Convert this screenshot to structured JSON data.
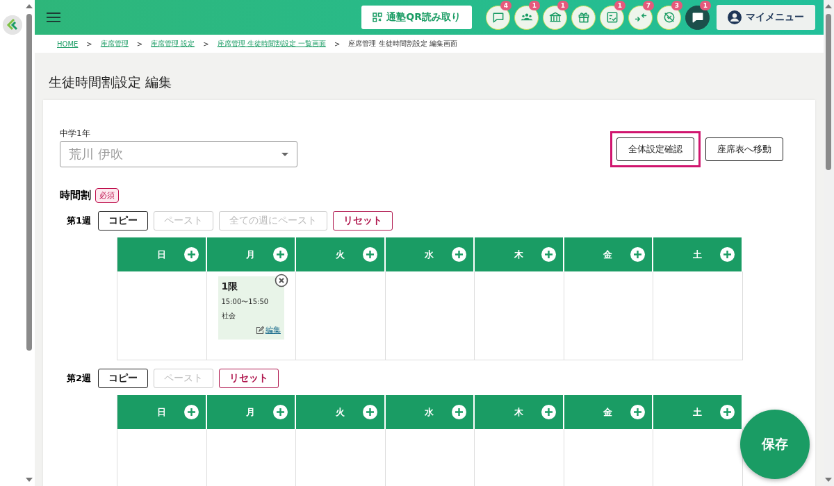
{
  "header": {
    "qr_button": "通塾QR読み取り",
    "icons": [
      {
        "kind": "chat",
        "badge": "4",
        "active": false
      },
      {
        "kind": "group",
        "badge": "1",
        "active": false
      },
      {
        "kind": "school",
        "badge": "1",
        "active": false
      },
      {
        "kind": "gift",
        "active": false
      },
      {
        "kind": "checklist",
        "badge": "1",
        "active": false
      },
      {
        "kind": "merge",
        "badge": "7",
        "active": false
      },
      {
        "kind": "blocked",
        "badge": "3",
        "active": false
      },
      {
        "kind": "chat",
        "badge": "1",
        "active": true
      }
    ],
    "menu": "マイメニュー"
  },
  "breadcrumb": [
    {
      "kind": "link",
      "label": "HOME"
    },
    {
      "kind": "separator",
      "label": ">"
    },
    {
      "kind": "link",
      "label": "座席管理"
    },
    {
      "kind": "separator",
      "label": ">"
    },
    {
      "kind": "link",
      "label": "座席管理 設定"
    },
    {
      "kind": "separator",
      "label": ">"
    },
    {
      "kind": "link",
      "label": "座席管理 生徒時間割設定 一覧画面"
    },
    {
      "kind": "separator",
      "label": ">"
    },
    {
      "kind": "current",
      "label": "座席管理 生徒時間割設定 編集画面"
    }
  ],
  "page_title": "生徒時間割設定 編集",
  "student": {
    "label": "中学1年",
    "value": "荒川 伊吹"
  },
  "actions": [
    {
      "label": "全体設定確認",
      "highlighted": true
    },
    {
      "label": "座席表へ移動",
      "highlighted": false
    }
  ],
  "timetable": {
    "label": "時間割",
    "required_badge": "必須",
    "weeks": [
      {
        "label": "第1週",
        "buttons": [
          {
            "kind": "copy",
            "label": "コピー",
            "disabled": false
          },
          {
            "kind": "paste",
            "label": "ペースト",
            "disabled": true
          },
          {
            "kind": "paste",
            "label": "全ての週にペースト",
            "disabled": true
          },
          {
            "kind": "reset",
            "label": "リセット",
            "disabled": false
          }
        ],
        "days": [
          {
            "label": "日"
          },
          {
            "label": "月",
            "entries": [
              {
                "period": "1限",
                "time": "15:00〜15:50",
                "subject": "社会",
                "edit": "編集"
              }
            ]
          },
          {
            "label": "火"
          },
          {
            "label": "水"
          },
          {
            "label": "木"
          },
          {
            "label": "金"
          },
          {
            "label": "土"
          }
        ]
      },
      {
        "label": "第2週",
        "buttons": [
          {
            "kind": "copy",
            "label": "コピー",
            "disabled": false
          },
          {
            "kind": "paste",
            "label": "ペースト",
            "disabled": true
          },
          {
            "kind": "reset",
            "label": "リセット",
            "disabled": false
          }
        ],
        "days": [
          {
            "label": "日"
          },
          {
            "label": "月"
          },
          {
            "label": "火"
          },
          {
            "label": "水"
          },
          {
            "label": "木"
          },
          {
            "label": "金"
          },
          {
            "label": "土"
          }
        ]
      }
    ]
  },
  "save_button": "保存"
}
